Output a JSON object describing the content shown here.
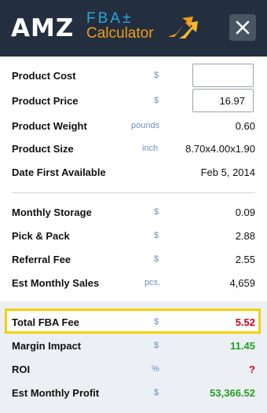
{
  "header": {
    "logo_main": "AMZ",
    "logo_fba": "FBA±",
    "logo_calc": "Calculator",
    "close_label": "×"
  },
  "product": {
    "cost": {
      "label": "Product Cost",
      "unit": "$",
      "value": ""
    },
    "price": {
      "label": "Product Price",
      "unit": "$",
      "value": "16.97"
    },
    "weight": {
      "label": "Product Weight",
      "unit": "pounds",
      "value": "0.60"
    },
    "size": {
      "label": "Product Size",
      "unit": "inch",
      "value": "8.70x4.00x1.90"
    },
    "date": {
      "label": "Date First Available",
      "value": "Feb 5, 2014"
    }
  },
  "fees": {
    "storage": {
      "label": "Monthly Storage",
      "unit": "$",
      "value": "0.09"
    },
    "pick": {
      "label": "Pick & Pack",
      "unit": "$",
      "value": "2.88"
    },
    "referral": {
      "label": "Referral Fee",
      "unit": "$",
      "value": "2.55"
    },
    "sales": {
      "label": "Est Monthly Sales",
      "unit": "pcs.",
      "value": "4,659"
    }
  },
  "summary": {
    "total": {
      "label": "Total FBA Fee",
      "unit": "$",
      "value": "5.52"
    },
    "margin": {
      "label": "Margin Impact",
      "unit": "$",
      "value": "11.45"
    },
    "roi": {
      "label": "ROI",
      "unit": "%",
      "value": "?"
    },
    "profit": {
      "label": "Est Monthly Profit",
      "unit": "$",
      "value": "53,366.52"
    }
  },
  "colors": {
    "header_bg": "#232f3e",
    "fba_blue": "#28a8e0",
    "calc_orange": "#f39c1b",
    "highlight": "#f2d200",
    "negative": "#d0021b",
    "positive": "#21a121"
  }
}
